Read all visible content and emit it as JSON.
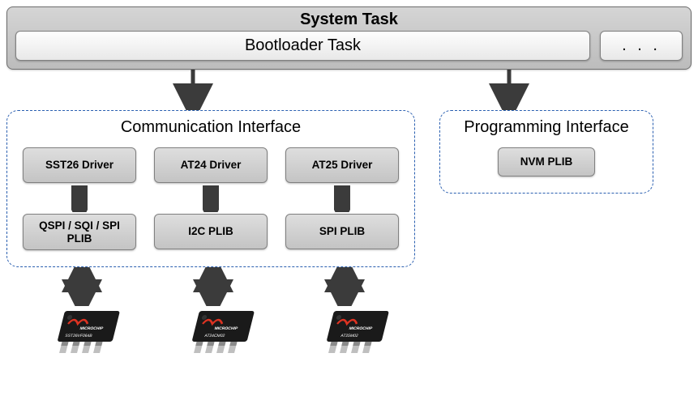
{
  "system": {
    "title": "System Task",
    "bootloader": "Bootloader Task",
    "dots": ". . ."
  },
  "comm": {
    "title": "Communication Interface",
    "columns": [
      {
        "driver": "SST26 Driver",
        "plib": "QSPI / SQI / SPI PLIB",
        "chip_label": "SST26VF064B"
      },
      {
        "driver": "AT24 Driver",
        "plib": "I2C PLIB",
        "chip_label": "AT24CM02"
      },
      {
        "driver": "AT25 Driver",
        "plib": "SPI PLIB",
        "chip_label": "AT25M02"
      }
    ]
  },
  "prog": {
    "title": "Programming Interface",
    "plib": "NVM PLIB"
  },
  "chip_brand": "MICROCHIP"
}
